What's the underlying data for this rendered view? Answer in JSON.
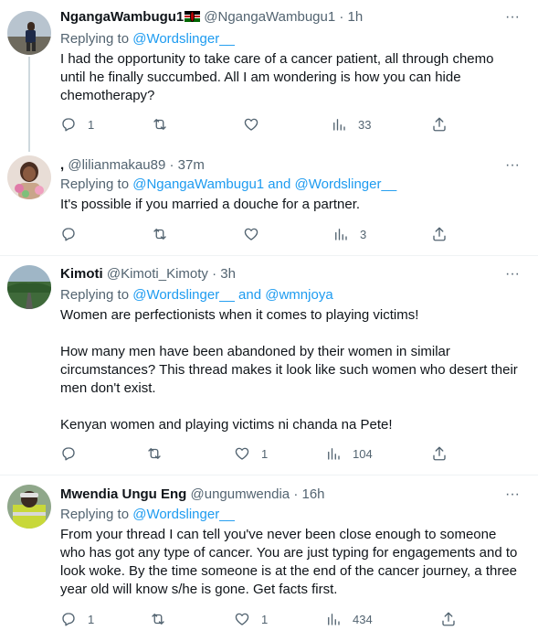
{
  "tweets": [
    {
      "name": "NgangaWambugu1",
      "has_flag": true,
      "handle": "@NgangaWambugu1",
      "time": "1h",
      "replying_label": "Replying to",
      "replying_mentions": "@Wordslinger__",
      "body": [
        "I had the opportunity to take care of a cancer patient, all through chemo until he finally succumbed. All I am wondering is how you can hide chemotherapy?"
      ],
      "actions": {
        "reply": "1",
        "retweet": "",
        "like": "",
        "views": "33"
      }
    },
    {
      "name": ",",
      "handle": "@lilianmakau89",
      "time": "37m",
      "replying_label": "Replying to",
      "replying_mentions": "@NgangaWambugu1 and @Wordslinger__",
      "body": [
        "It's possible if you married a douche for a partner."
      ],
      "actions": {
        "reply": "",
        "retweet": "",
        "like": "",
        "views": "3"
      }
    },
    {
      "name": "Kimoti",
      "handle": "@Kimoti_Kimoty",
      "time": "3h",
      "replying_label": "Replying to",
      "replying_mentions": "@Wordslinger__ and @wmnjoya",
      "body": [
        "Women are perfectionists when it comes to playing victims!",
        "",
        "How many men have been abandoned by their women in similar circumstances? This thread makes it look like such women who desert their men don't exist.",
        "",
        "Kenyan women and playing victims ni chanda na Pete!"
      ],
      "actions": {
        "reply": "",
        "retweet": "",
        "like": "1",
        "views": "104"
      }
    },
    {
      "name": "Mwendia Ungu Eng",
      "handle": "@ungumwendia",
      "time": "16h",
      "replying_label": "Replying to",
      "replying_mentions": "@Wordslinger__",
      "body": [
        "From your thread I can tell you've never been close enough to someone who has got any type of cancer. You are just typing for engagements and to look woke. By the time someone is at the end of the cancer journey, a three year old will know s/he is gone. Get facts first."
      ],
      "actions": {
        "reply": "1",
        "retweet": "",
        "like": "1",
        "views": "434"
      }
    }
  ],
  "separator_dot": "·",
  "more_glyph": "···",
  "icons": {
    "reply": "reply-icon",
    "retweet": "retweet-icon",
    "like": "like-icon",
    "views": "views-icon",
    "share": "share-icon",
    "more": "more-icon"
  },
  "colors": {
    "text": "#0f1419",
    "muted": "#536471",
    "link": "#1d9bf0",
    "divider": "#eff3f4",
    "thread_line": "#cfd9de"
  }
}
